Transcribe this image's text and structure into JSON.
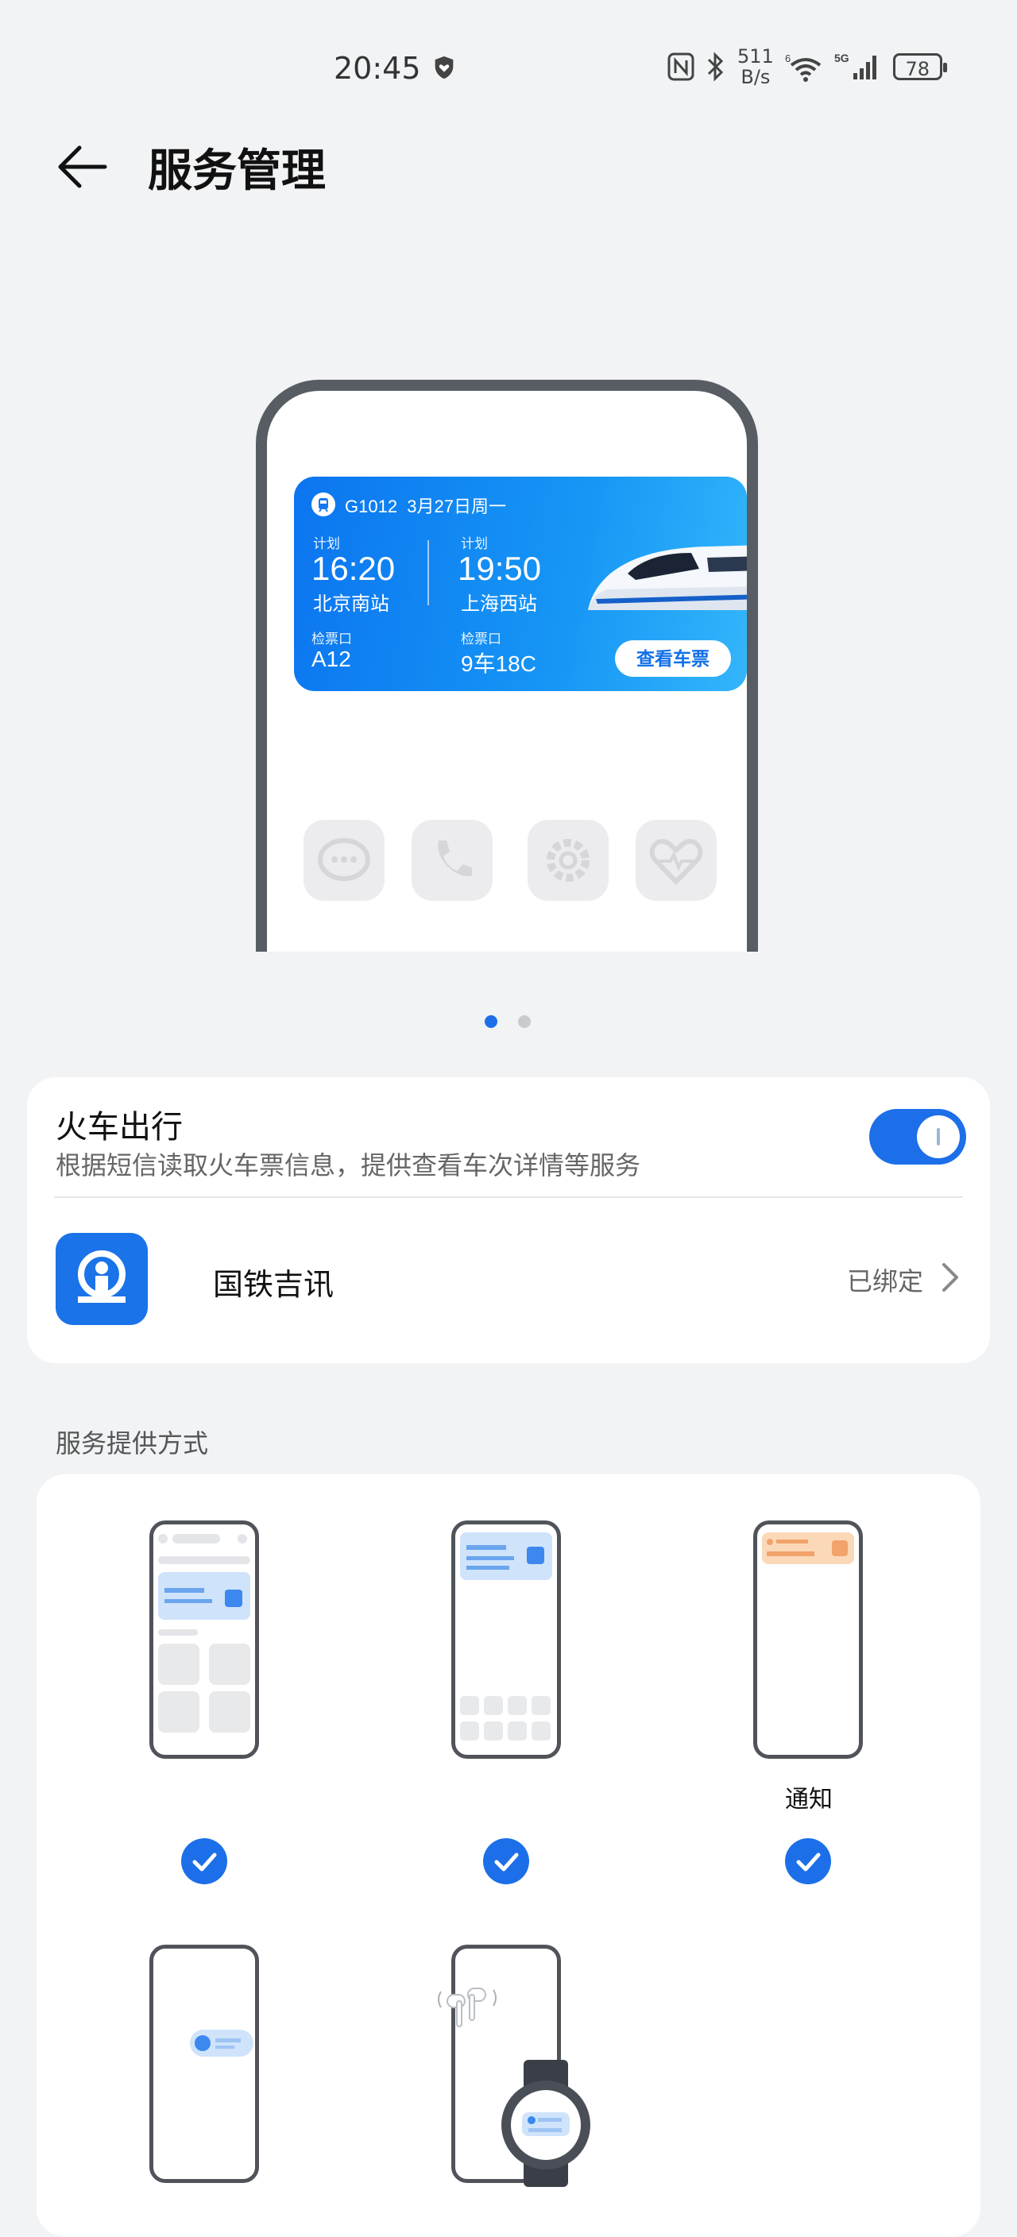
{
  "status_bar": {
    "time": "20:45",
    "net_speed_top": "511",
    "net_speed_bottom": "B/s",
    "battery": "78",
    "network_5g": "5G",
    "network_6": "6"
  },
  "header": {
    "title": "服务管理"
  },
  "preview_card": {
    "train_no": "G1012",
    "date": "3月27日周一",
    "dep_label": "计划",
    "dep_time": "16:20",
    "dep_station": "北京南站",
    "arr_label": "计划",
    "arr_time": "19:50",
    "arr_station": "上海西站",
    "gate_label": "检票口",
    "gate": "A12",
    "seat_label": "检票口",
    "seat": "9车18C",
    "button": "查看车票"
  },
  "pager": {
    "count": 2,
    "active": 0
  },
  "service": {
    "title": "火车出行",
    "description": "根据短信读取火车票信息，提供查看车次详情等服务",
    "enabled": true,
    "app_name": "国铁吉讯",
    "status": "已绑定"
  },
  "delivery": {
    "section_title": "服务提供方式",
    "options": [
      {
        "label": "",
        "checked": true
      },
      {
        "label": "",
        "checked": true
      },
      {
        "label": "通知",
        "checked": true
      },
      {
        "label": "",
        "checked": false
      },
      {
        "label": "",
        "checked": false
      }
    ]
  },
  "colors": {
    "accent": "#1c6fe8",
    "card_blue": "#1696f5",
    "background": "#f1f3f5"
  }
}
